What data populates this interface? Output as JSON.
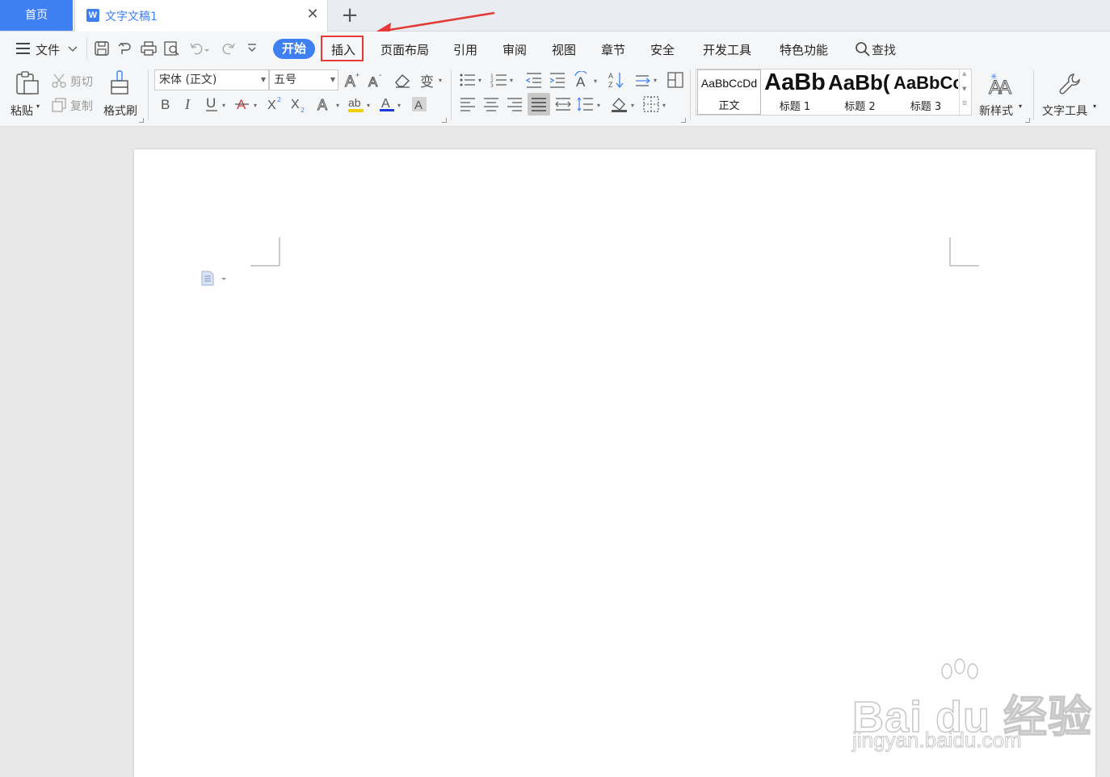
{
  "titlebar": {
    "home_tab": "首页",
    "doc_tab": "文字文稿1",
    "doc_icon": "W",
    "close_glyph": "✕",
    "new_tab_glyph": "+"
  },
  "menubar": {
    "file_label": "文件",
    "tabs": [
      "开始",
      "插入",
      "页面布局",
      "引用",
      "审阅",
      "视图",
      "章节",
      "安全",
      "开发工具",
      "特色功能"
    ],
    "search_label": "查找"
  },
  "ribbon": {
    "paste_label": "粘贴",
    "cut_label": "剪切",
    "copy_label": "复制",
    "format_painter_label": "格式刷",
    "font_name": "宋体 (正文)",
    "font_size": "五号",
    "styles": [
      {
        "sample": "AaBbCcDd",
        "name": "正文"
      },
      {
        "sample": "AaBb",
        "name": "标题 1"
      },
      {
        "sample": "AaBb(",
        "name": "标题 2"
      },
      {
        "sample": "AaBbCc",
        "name": "标题 3"
      }
    ],
    "new_style_label": "新样式",
    "text_tools_label": "文字工具"
  },
  "annotation": {
    "color": "#e53935"
  },
  "watermark": {
    "big": "Bai du 经验",
    "small": "jingyan.baidu.com"
  },
  "colors": {
    "accent": "#3e7ff2",
    "highlight_red": "#e53935"
  }
}
